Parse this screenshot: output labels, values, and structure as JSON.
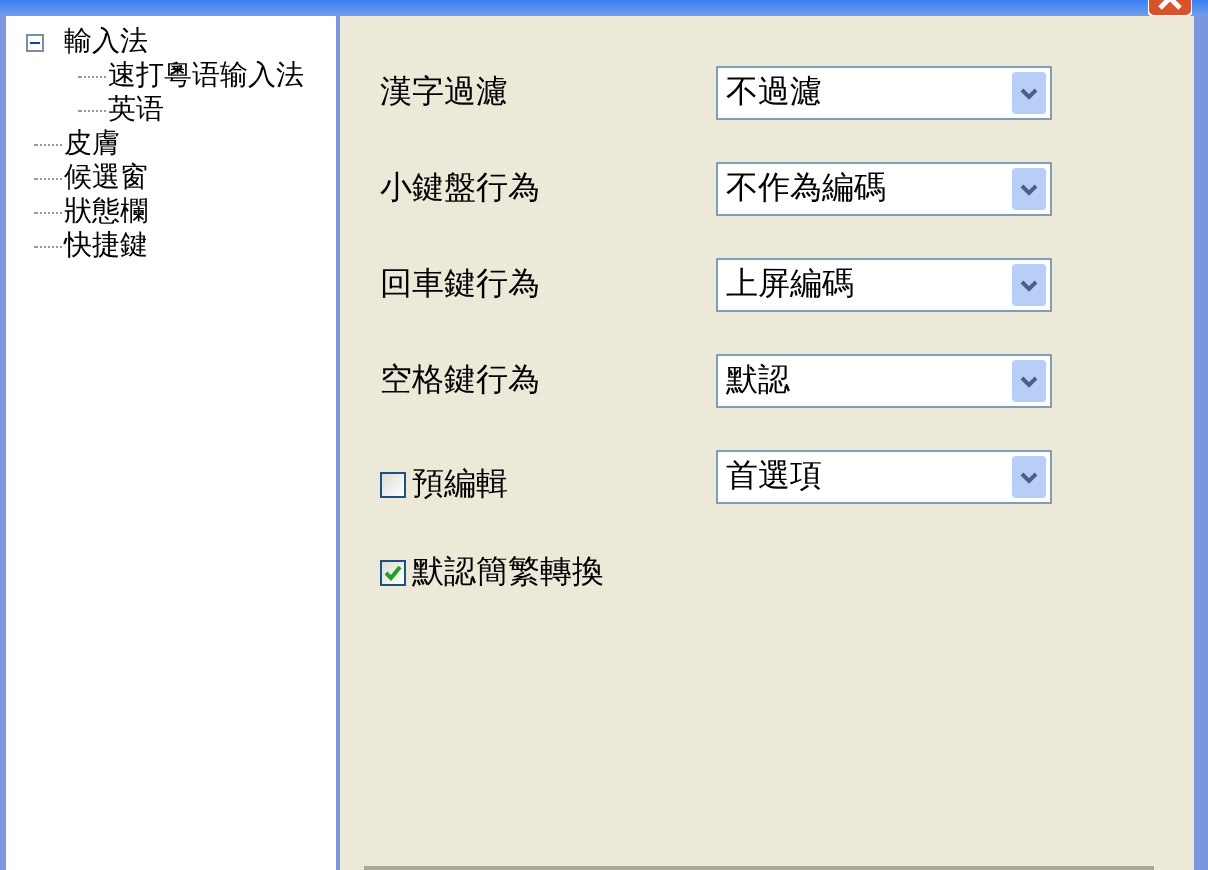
{
  "tree": [
    {
      "label": "輸入法",
      "expanded": true,
      "children": [
        {
          "label": "速打粵语输入法"
        },
        {
          "label": "英语"
        }
      ]
    },
    {
      "label": "皮膚"
    },
    {
      "label": "候選窗"
    },
    {
      "label": "狀態欄"
    },
    {
      "label": "快捷鍵"
    }
  ],
  "settings": [
    {
      "kind": "select",
      "label": "漢字過濾",
      "value": "不過濾"
    },
    {
      "kind": "select",
      "label": "小鍵盤行為",
      "value": "不作為編碼"
    },
    {
      "kind": "select",
      "label": "回車鍵行為",
      "value": "上屏編碼"
    },
    {
      "kind": "select",
      "label": "空格鍵行為",
      "value": "默認"
    },
    {
      "kind": "checkbox_select",
      "label": "預編輯",
      "checked": false,
      "value": "首選項"
    },
    {
      "kind": "checkbox",
      "label": "默認簡繁轉換",
      "checked": true
    }
  ]
}
